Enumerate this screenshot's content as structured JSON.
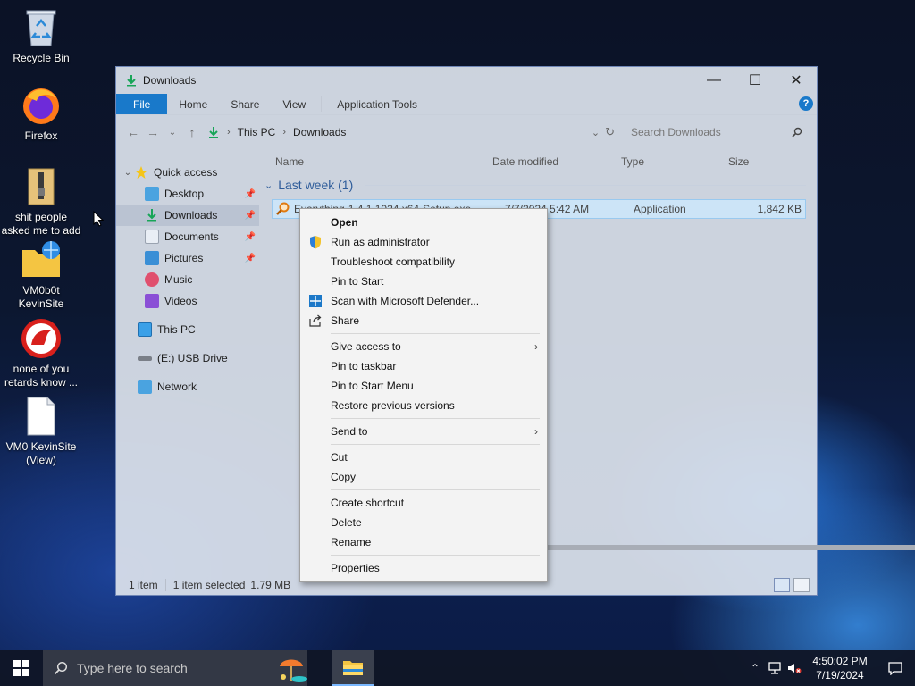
{
  "desktop_icons": [
    {
      "name": "recycle-bin",
      "label": "Recycle Bin"
    },
    {
      "name": "firefox",
      "label": "Firefox"
    },
    {
      "name": "folder-shit",
      "label": "shit people asked me to add"
    },
    {
      "name": "vm0b0t-kevinsite",
      "label": "VM0b0t KevinSite"
    },
    {
      "name": "none-of-you",
      "label": "none of you retards know ..."
    },
    {
      "name": "vm0-kevinsite-view",
      "label": "VM0 KevinSite (View)"
    }
  ],
  "window": {
    "title": "Downloads",
    "ribbon_tabs": [
      "File",
      "Home",
      "Share",
      "View",
      "Application Tools"
    ],
    "help_label": "?",
    "breadcrumb": [
      "This PC",
      "Downloads"
    ],
    "search_placeholder": "Search Downloads",
    "columns": [
      "Name",
      "Date modified",
      "Type",
      "Size"
    ],
    "group_label": "Last week (1)",
    "file": {
      "name": "Everything-1.4.1.1024.x64-Setup.exe",
      "date": "7/7/2024 5:42 AM",
      "type": "Application",
      "size": "1,842 KB"
    },
    "nav": {
      "quick_access": "Quick access",
      "items": [
        "Desktop",
        "Downloads",
        "Documents",
        "Pictures",
        "Music",
        "Videos"
      ],
      "this_pc": "This PC",
      "usb": "(E:) USB Drive",
      "network": "Network"
    },
    "status": {
      "count": "1 item",
      "selected": "1 item selected",
      "size": "1.79 MB"
    }
  },
  "context_menu": {
    "group1": [
      "Open",
      "Run as administrator",
      "Troubleshoot compatibility",
      "Pin to Start",
      "Scan with Microsoft Defender...",
      "Share"
    ],
    "group2": [
      "Give access to",
      "Pin to taskbar",
      "Pin to Start Menu",
      "Restore previous versions"
    ],
    "group3": [
      "Send to"
    ],
    "group4": [
      "Cut",
      "Copy"
    ],
    "group5": [
      "Create shortcut",
      "Delete",
      "Rename"
    ],
    "group6": [
      "Properties"
    ]
  },
  "taskbar": {
    "search_placeholder": "Type here to search",
    "time": "4:50:02 PM",
    "date": "7/19/2024"
  },
  "colors": {
    "accent": "#1979ca",
    "selection": "#cce4f7",
    "group_header": "#2e5c9a"
  }
}
